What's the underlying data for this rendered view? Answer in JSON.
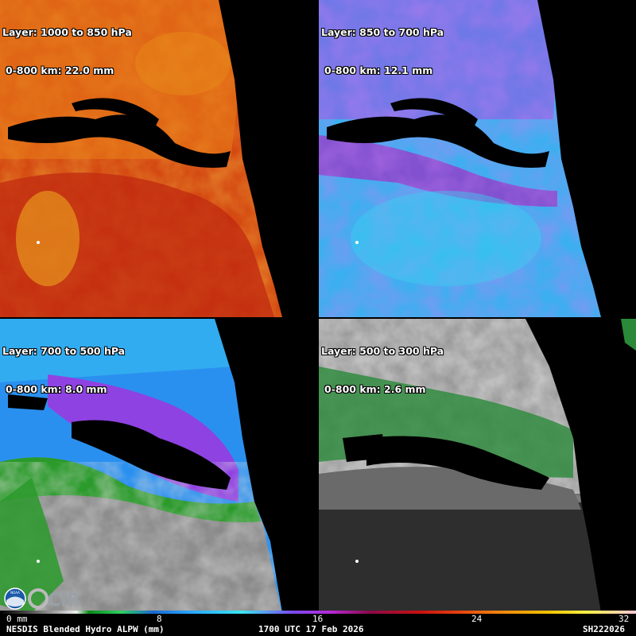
{
  "panels": [
    {
      "layer": "Layer: 1000 to 850 hPa",
      "stat": "0-800 km: 22.0 mm"
    },
    {
      "layer": "Layer: 850 to 700 hPa",
      "stat": "0-800 km: 12.1 mm"
    },
    {
      "layer": "Layer: 700 to 500 hPa",
      "stat": "0-800 km: 8.0 mm"
    },
    {
      "layer": "Layer: 500 to 300 hPa",
      "stat": "0-800 km: 2.6 mm"
    }
  ],
  "colorbar": {
    "ticks": [
      "0 mm",
      "8",
      "16",
      "24",
      "32"
    ],
    "stops": [
      "#000000",
      "#aaaaaa",
      "#0a8a1a",
      "#2aa6ff",
      "#3ae6f0",
      "#b62ad8",
      "#c81010",
      "#f08010",
      "#f8f040",
      "#f8c8d8"
    ]
  },
  "footer": {
    "product": "NESDIS Blended Hydro ALPW (mm)",
    "time": "1700 UTC 17 Feb 2026",
    "id": "SH222026"
  },
  "logos": [
    "NOAA",
    "CIRA"
  ],
  "colors": {
    "panel1": [
      "#c83a10",
      "#e86a10",
      "#f0a020",
      "#a8300c"
    ],
    "panel2": [
      "#9a3ad8",
      "#3ad0f0",
      "#3aa8f0",
      "#c02a8a"
    ],
    "panel3": [
      "#3a8af0",
      "#a03ae0",
      "#2a9a2a",
      "#9a9a9a"
    ],
    "panel4": [
      "#8a8a8a",
      "#2a8a3a",
      "#3a3a3a",
      "#cfcfcf"
    ]
  }
}
